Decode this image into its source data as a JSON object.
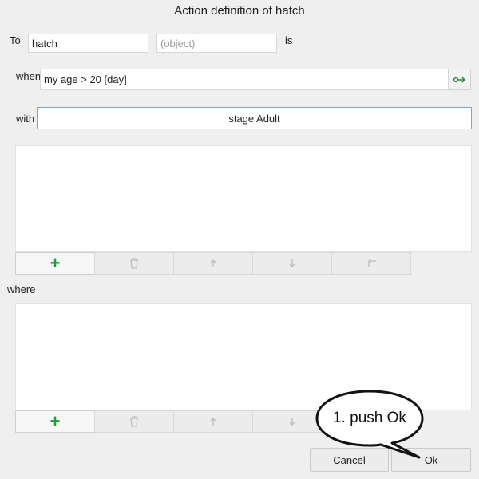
{
  "dialog": {
    "title": "Action definition of hatch"
  },
  "header": {
    "to_label": "To",
    "name_value": "hatch",
    "type_placeholder": "(object)",
    "is_label": "is"
  },
  "when": {
    "label": "when",
    "value": "my age > 20 [day]",
    "button_icon": "condition-icon"
  },
  "with": {
    "label": "with",
    "value": "stage Adult"
  },
  "effects_toolbar": {
    "add_icon": "plus-icon",
    "delete_icon": "trash-icon",
    "up_icon": "arrow-up-icon",
    "down_icon": "arrow-down-icon",
    "undo_icon": "undo-icon"
  },
  "where": {
    "label": "where"
  },
  "footer": {
    "cancel_label": "Cancel",
    "ok_label": "Ok"
  },
  "callout": {
    "text": "1. push Ok"
  },
  "colors": {
    "plus": "#1e9e3a",
    "focus_border": "#7fa6cc"
  }
}
